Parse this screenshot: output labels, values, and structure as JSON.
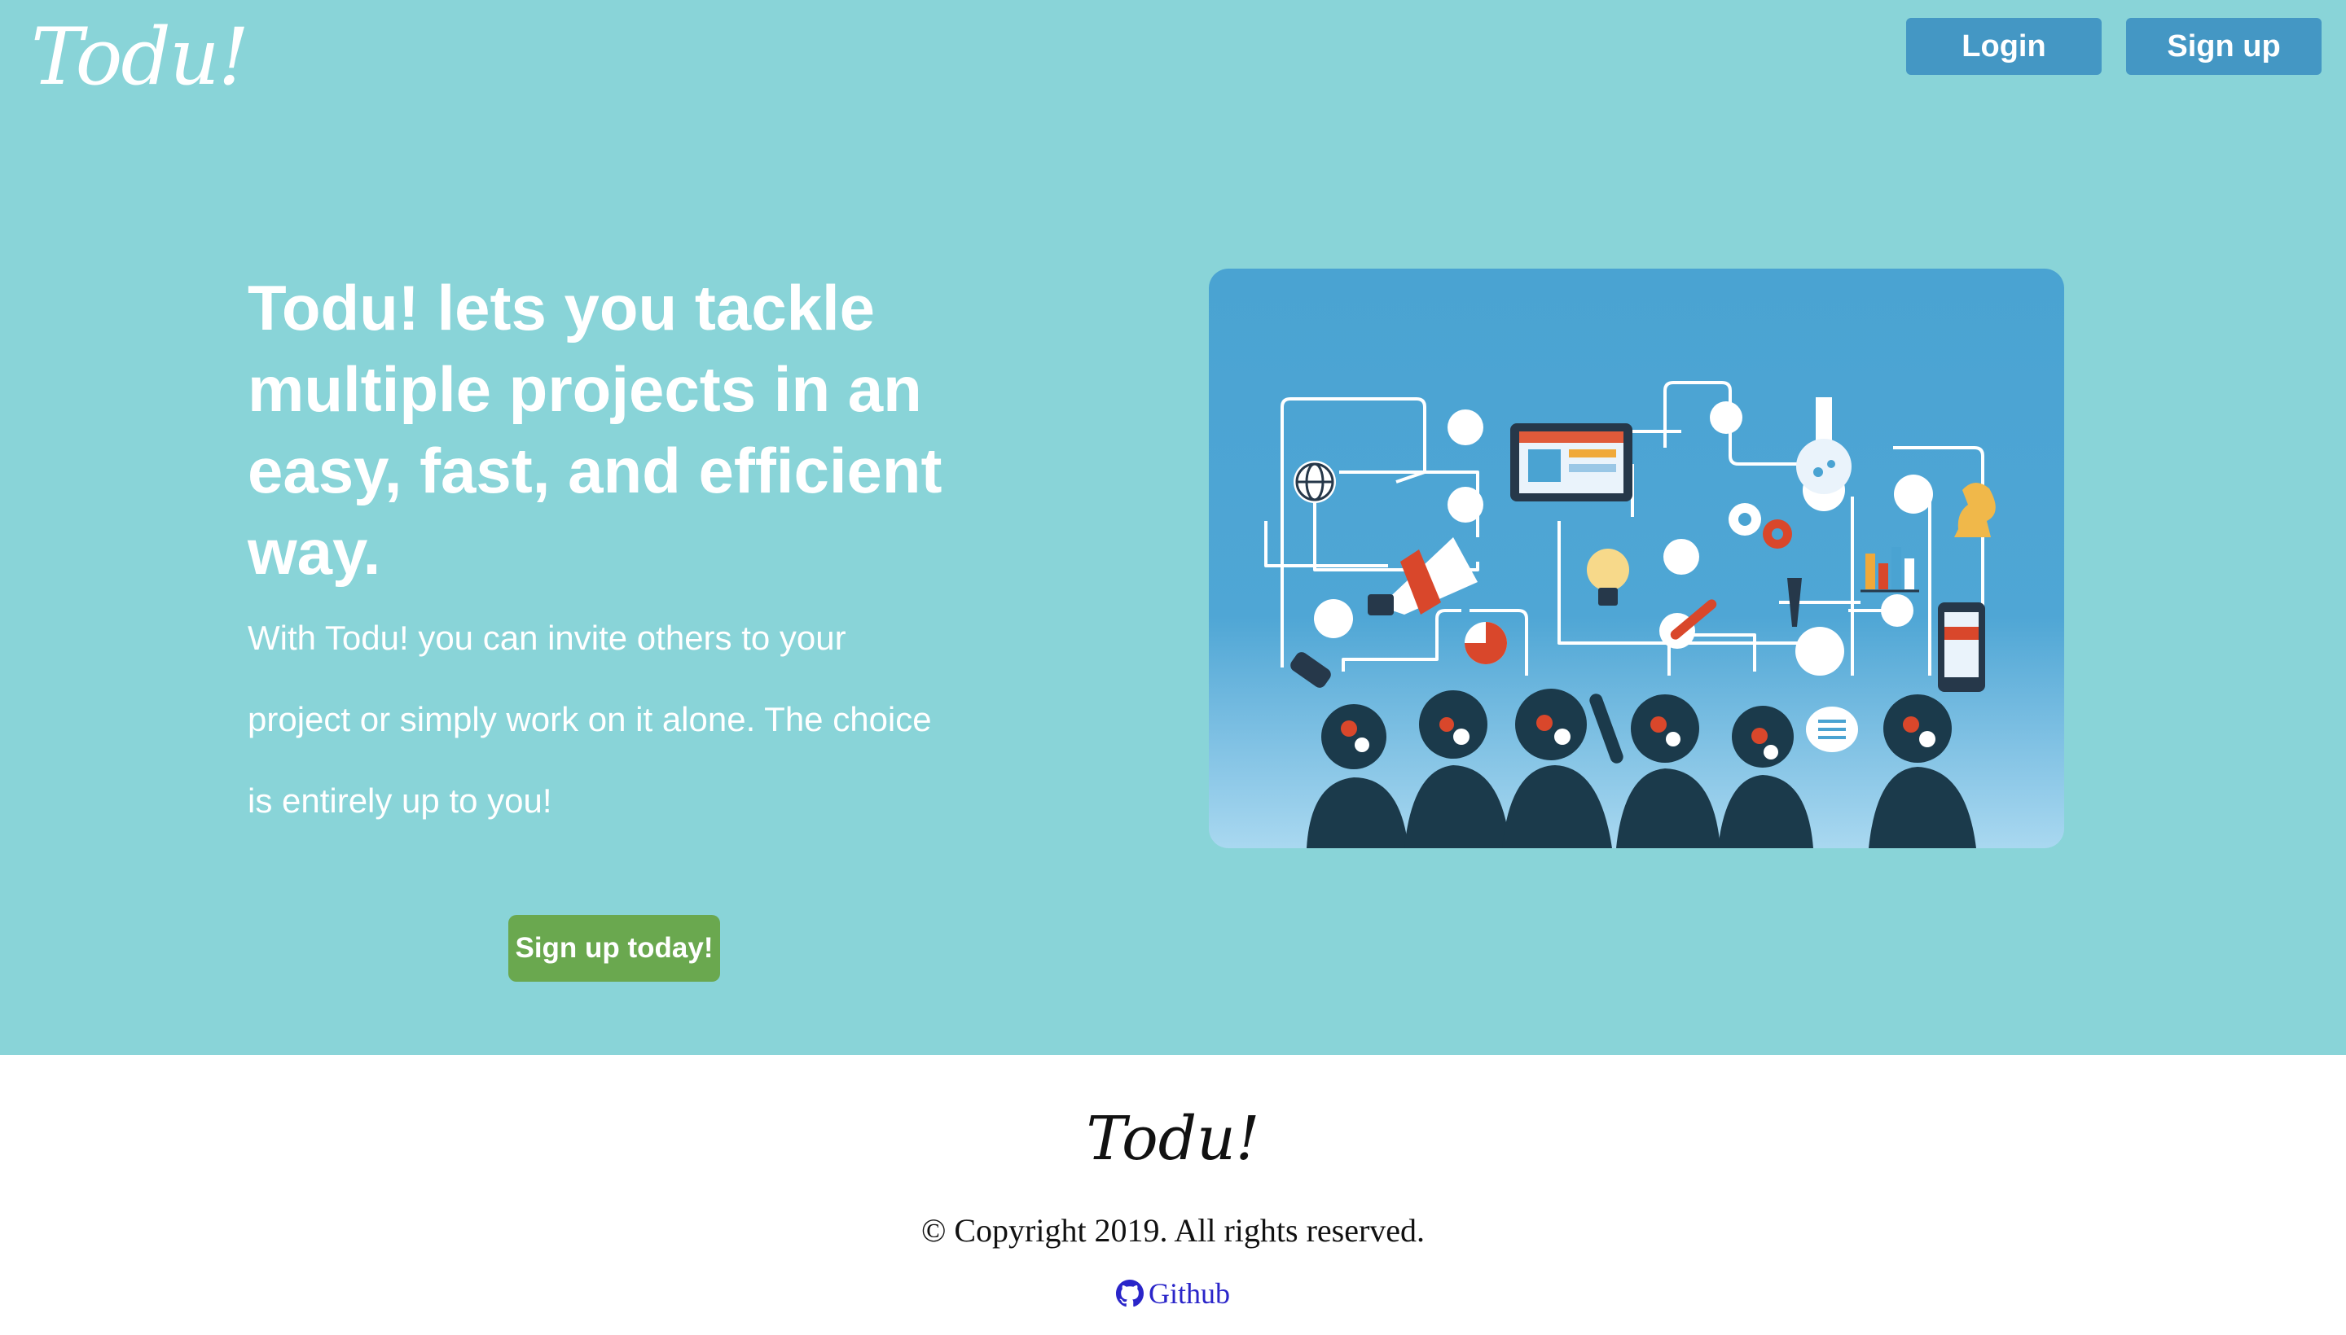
{
  "header": {
    "brand": "Todu!",
    "login_label": "Login",
    "signup_label": "Sign up"
  },
  "hero": {
    "headline": "Todu! lets you tackle multiple projects in an easy, fast, and efficient way.",
    "subtext": "With Todu! you can invite others to your project or simply work on it alone. The choice is entirely up to you!",
    "cta_label": "Sign up today!",
    "illustration_icon": "team-workflow-illustration"
  },
  "footer": {
    "brand": "Todu!",
    "copyright": "© Copyright 2019. All rights reserved.",
    "github_label": "Github",
    "github_icon": "github-icon"
  },
  "colors": {
    "hero_bg": "#89d4d8",
    "nav_button": "#4497c4",
    "cta_button": "#6aa84f",
    "link": "#2a25c9"
  }
}
